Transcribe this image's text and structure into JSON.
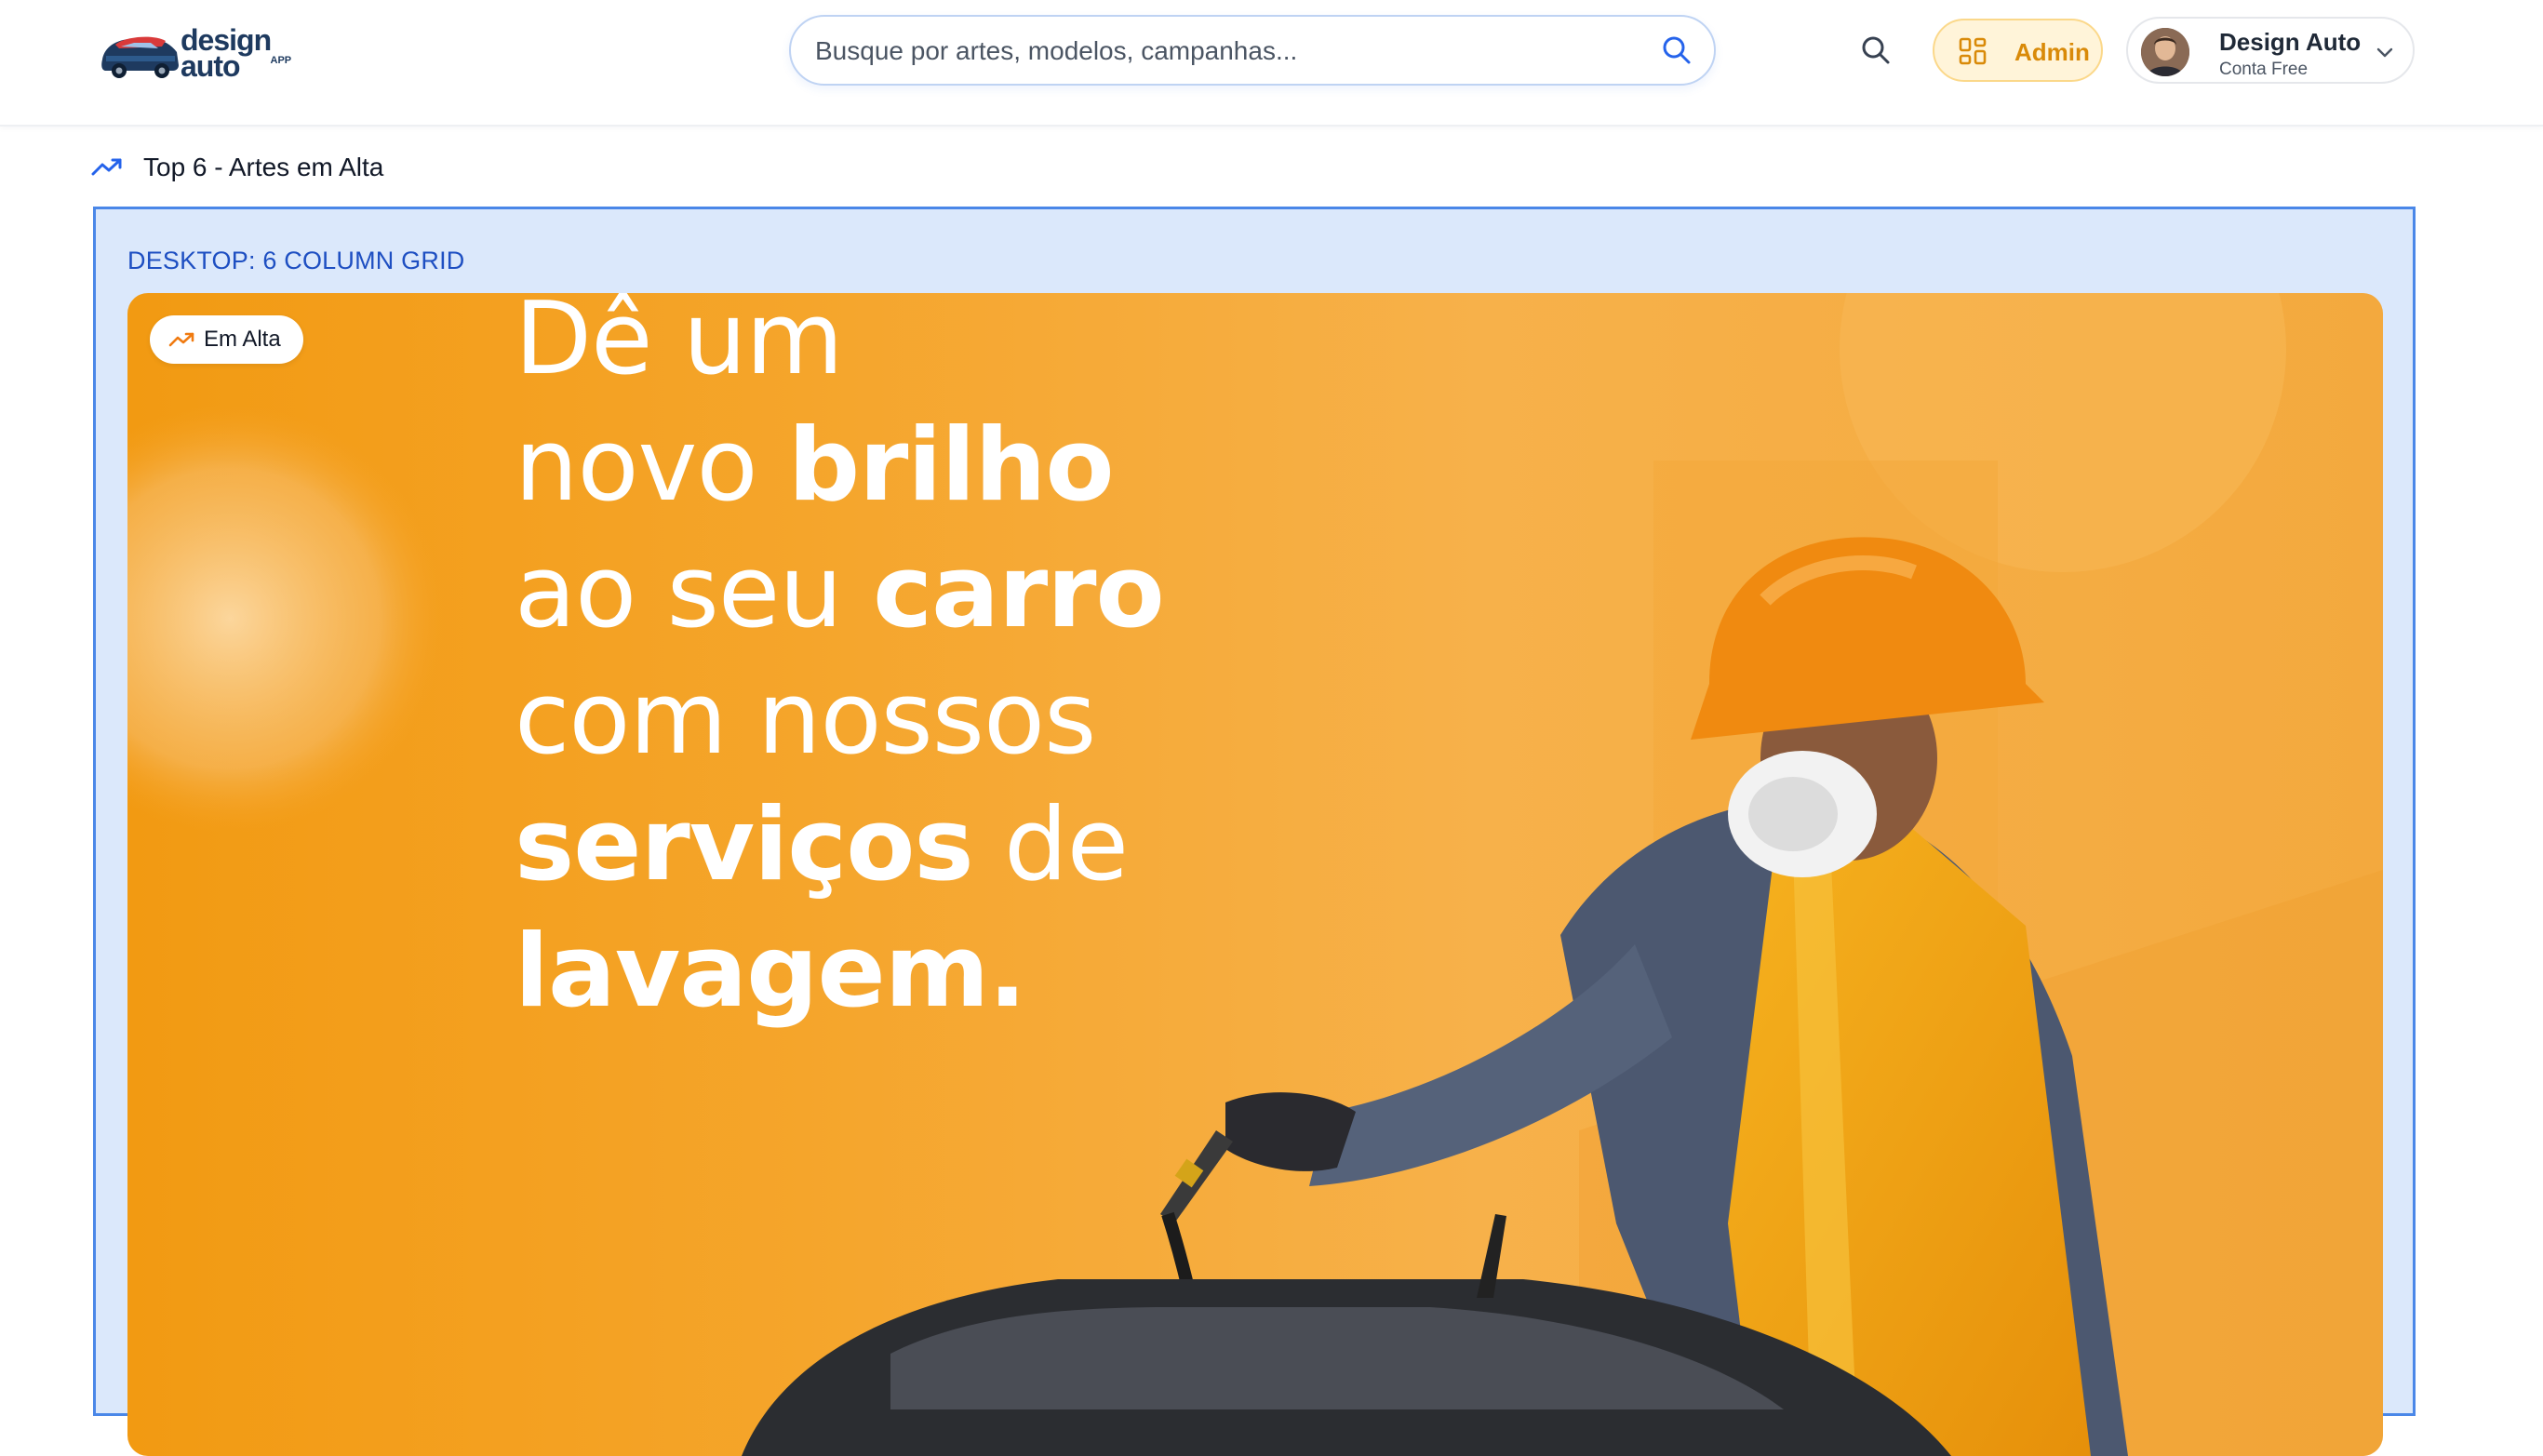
{
  "header": {
    "logo": {
      "line1": "design",
      "line2": "auto",
      "suffix": "APP"
    },
    "search": {
      "placeholder": "Busque por artes, modelos, campanhas..."
    },
    "admin_label": "Admin",
    "user": {
      "name": "Design Auto",
      "plan": "Conta Free"
    }
  },
  "section": {
    "title": "Top 6 - Artes em Alta",
    "grid_label": "DESKTOP: 6 COLUMN GRID"
  },
  "card": {
    "badge": "Em Alta",
    "headline": [
      {
        "regular": "Dê um",
        "bold": ""
      },
      {
        "regular": "novo ",
        "bold": "brilho"
      },
      {
        "regular": "ao seu ",
        "bold": "carro"
      },
      {
        "regular": "com nossos",
        "bold": ""
      },
      {
        "regular": "",
        "bold": "serviços",
        "regular_after": " de"
      },
      {
        "regular": "",
        "bold": "lavagem."
      }
    ]
  },
  "colors": {
    "accent_blue": "#2563eb",
    "admin_bg": "#fff4d9",
    "admin_text": "#d98a09",
    "grid_bg": "#dbe8fb",
    "grid_border": "#4a87e8",
    "card_orange": "#f29a12"
  },
  "icons": {
    "logo": "car-logo-icon",
    "search": "search-icon",
    "admin": "grid-icon",
    "user_menu": "chevron-down-icon",
    "trending": "trending-up-icon"
  }
}
